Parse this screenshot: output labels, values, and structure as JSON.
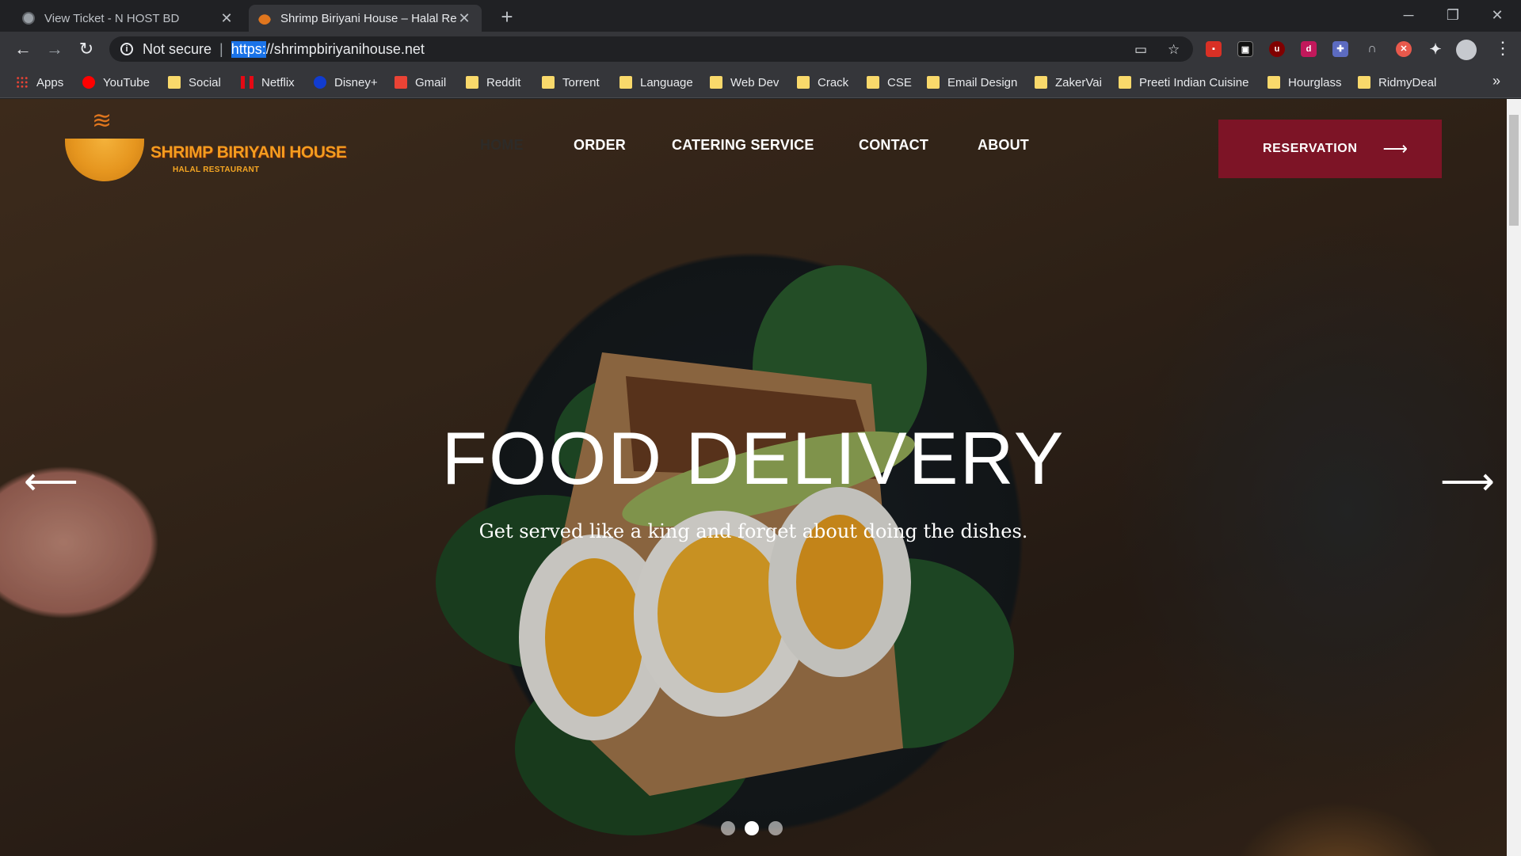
{
  "browser": {
    "tabs": [
      {
        "title": "View Ticket - N HOST BD",
        "active": false
      },
      {
        "title": "Shrimp Biriyani House – Halal Re",
        "active": true
      }
    ],
    "new_tab": "+",
    "window_controls": {
      "minimize": "─",
      "restore": "❐",
      "close": "✕"
    },
    "address": {
      "security_label": "Not secure",
      "separator": "|",
      "scheme": "https:",
      "rest": "//shrimpbiriyanihouse.net"
    },
    "bookmarks": [
      {
        "label": "Apps",
        "icon": "apps-grid-icon"
      },
      {
        "label": "YouTube",
        "icon": "youtube-icon"
      },
      {
        "label": "Social",
        "icon": "folder-icon"
      },
      {
        "label": "Netflix",
        "icon": "netflix-icon"
      },
      {
        "label": "Disney+",
        "icon": "disney-icon"
      },
      {
        "label": "Gmail",
        "icon": "gmail-icon"
      },
      {
        "label": "Reddit",
        "icon": "folder-icon"
      },
      {
        "label": "Torrent",
        "icon": "folder-icon"
      },
      {
        "label": "Language",
        "icon": "folder-icon"
      },
      {
        "label": "Web Dev",
        "icon": "folder-icon"
      },
      {
        "label": "Crack",
        "icon": "folder-icon"
      },
      {
        "label": "CSE",
        "icon": "folder-icon"
      },
      {
        "label": "Email Design",
        "icon": "folder-icon"
      },
      {
        "label": "ZakerVai",
        "icon": "folder-icon"
      },
      {
        "label": "Preeti Indian Cuisine",
        "icon": "folder-icon"
      },
      {
        "label": "Hourglass",
        "icon": "folder-icon"
      },
      {
        "label": "RidmyDeal",
        "icon": "folder-icon"
      }
    ],
    "bookmarks_more": "»"
  },
  "site": {
    "logo": {
      "name": "SHRIMP BIRIYANI HOUSE",
      "tagline": "HALAL RESTAURANT"
    },
    "nav": {
      "home": "HOME",
      "order": "ORDER",
      "catering": "CATERING SERVICE",
      "contact": "CONTACT",
      "about": "ABOUT"
    },
    "reservation": {
      "label": "RESERVATION",
      "arrow": "⟶"
    },
    "hero": {
      "title": "FOOD DELIVERY",
      "subtitle": "Get served like a king and forget about doing the dishes."
    },
    "slider": {
      "prev": "⟵",
      "next": "⟶",
      "slide_count": 3,
      "active_slide": 2
    }
  },
  "colors": {
    "brand_accent": "#7d1426",
    "logo_orange": "#f39c1f",
    "chrome_dark": "#202124",
    "chrome_mid": "#35363a"
  }
}
